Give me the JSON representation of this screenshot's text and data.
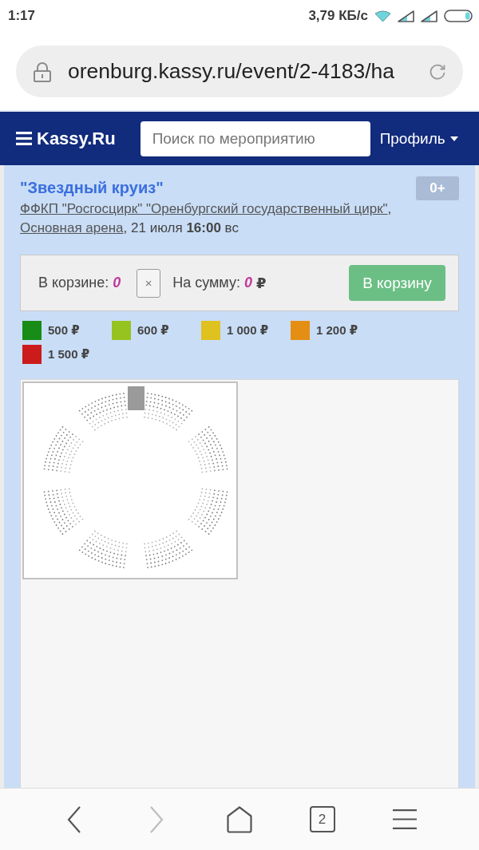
{
  "status_bar": {
    "time": "1:17",
    "network_speed": "3,79 КБ/с"
  },
  "address_bar": {
    "url": "orenburg.kassy.ru/event/2-4183/ha"
  },
  "navbar": {
    "logo": "Kassy.Ru",
    "search": {
      "placeholder": "Поиск по мероприятию"
    },
    "profile": "Профиль"
  },
  "event": {
    "title": "\"Звездный круиз\"",
    "age_rating": "0+",
    "details": [
      {
        "kind": "link",
        "text": "ФФКП \"Росгосцирк\" \"Оренбургский государственный цирк\""
      },
      {
        "kind": "text",
        "text": ","
      },
      {
        "kind": "link",
        "text": "Основная арена"
      },
      {
        "kind": "text",
        "text": ", 21 июля **16:00** вс"
      }
    ]
  },
  "cart": {
    "count_label": "В корзине:",
    "count": "0",
    "clear_button": "×",
    "sum_label": "На сумму:",
    "sum": "0",
    "currency": "₽",
    "add_button": "В корзину"
  },
  "price_legend": [
    {
      "price": "500 ₽",
      "color": "#178c17"
    },
    {
      "price": "600 ₽",
      "color": "#96c31f"
    },
    {
      "price": "1 000 ₽",
      "color": "#dfc11f"
    },
    {
      "price": "1 200 ₽",
      "color": "#e48e14"
    },
    {
      "price": "1 500 ₽",
      "color": "#cb1b1b"
    }
  ],
  "toolbar": {
    "buttons": [
      {
        "kind": "back",
        "disabled": false
      },
      {
        "kind": "forward",
        "disabled": true
      },
      {
        "kind": "home",
        "disabled": false
      },
      {
        "kind": "tabs",
        "disabled": false,
        "count": "2"
      },
      {
        "kind": "menu",
        "disabled": false
      }
    ]
  }
}
